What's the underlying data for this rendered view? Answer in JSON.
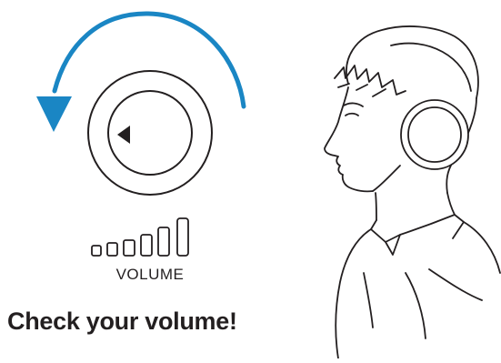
{
  "caption": {
    "volume_label": "VOLUME",
    "headline": "Check your volume!"
  },
  "volume_meter": {
    "bar_count": 6
  },
  "knob": {
    "rotation_direction": "counter-clockwise",
    "pointer": "left-triangle"
  },
  "icons": {
    "rotation": "curved-arrow-icon",
    "knob": "volume-knob-icon",
    "meter": "volume-level-icon",
    "person": "person-with-headphones-icon"
  },
  "colors": {
    "arrow": "#1a86c4",
    "line": "#231f20",
    "background": "#ffffff"
  }
}
